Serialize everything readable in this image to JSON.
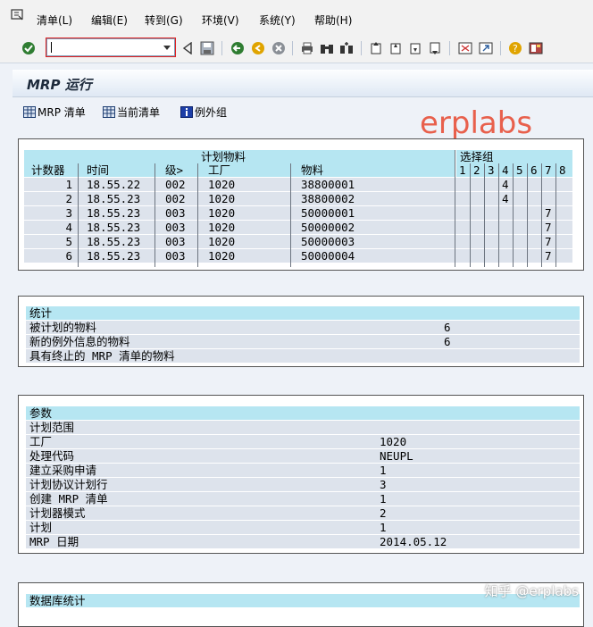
{
  "menu": [
    "清单(L)",
    "编辑(E)",
    "转到(G)",
    "环境(V)",
    "系统(Y)",
    "帮助(H)"
  ],
  "toolbar": {
    "command_value": ""
  },
  "title": "MRP 运行",
  "app_toolbar": {
    "mrp_list": "MRP 清单",
    "current_list": "当前清单",
    "exception_group": "例外组"
  },
  "watermark": "erplabs",
  "planned_materials": {
    "group_header": "计划物料",
    "selection_group_header": "选择组",
    "columns": [
      "计数器",
      "时间",
      "级>",
      "工厂",
      "物料"
    ],
    "selection_columns": [
      "1",
      "2",
      "3",
      "4",
      "5",
      "6",
      "7",
      "8"
    ],
    "rows": [
      {
        "counter": "1",
        "time": "18.55.22",
        "level": "002",
        "plant": "1020",
        "material": "38800001",
        "sel": [
          "",
          "",
          "",
          "4",
          "",
          "",
          "",
          ""
        ]
      },
      {
        "counter": "2",
        "time": "18.55.23",
        "level": "002",
        "plant": "1020",
        "material": "38800002",
        "sel": [
          "",
          "",
          "",
          "4",
          "",
          "",
          "",
          ""
        ]
      },
      {
        "counter": "3",
        "time": "18.55.23",
        "level": "003",
        "plant": "1020",
        "material": "50000001",
        "sel": [
          "",
          "",
          "",
          "",
          "",
          "",
          "7",
          ""
        ]
      },
      {
        "counter": "4",
        "time": "18.55.23",
        "level": "003",
        "plant": "1020",
        "material": "50000002",
        "sel": [
          "",
          "",
          "",
          "",
          "",
          "",
          "7",
          ""
        ]
      },
      {
        "counter": "5",
        "time": "18.55.23",
        "level": "003",
        "plant": "1020",
        "material": "50000003",
        "sel": [
          "",
          "",
          "",
          "",
          "",
          "",
          "7",
          ""
        ]
      },
      {
        "counter": "6",
        "time": "18.55.23",
        "level": "003",
        "plant": "1020",
        "material": "50000004",
        "sel": [
          "",
          "",
          "",
          "",
          "",
          "",
          "7",
          ""
        ]
      }
    ]
  },
  "statistics": {
    "header": "统计",
    "items": [
      {
        "label": "被计划的物料",
        "value": "6"
      },
      {
        "label": "新的例外信息的物料",
        "value": "6"
      },
      {
        "label": "具有终止的 MRP 清单的物料",
        "value": ""
      }
    ]
  },
  "parameters": {
    "header": "参数",
    "items": [
      {
        "label": "计划范围",
        "value": ""
      },
      {
        "label": "工厂",
        "value": "1020"
      },
      {
        "label": "处理代码",
        "value": "NEUPL"
      },
      {
        "label": "建立采购申请",
        "value": "1"
      },
      {
        "label": "计划协议计划行",
        "value": "3"
      },
      {
        "label": "创建 MRP 清单",
        "value": "1"
      },
      {
        "label": "计划器模式",
        "value": "2"
      },
      {
        "label": "计划",
        "value": "1"
      },
      {
        "label": "MRP 日期",
        "value": "2014.05.12"
      }
    ]
  },
  "database_stats": {
    "header": "数据库统计"
  },
  "footer_watermark": "知乎 @erplabs"
}
